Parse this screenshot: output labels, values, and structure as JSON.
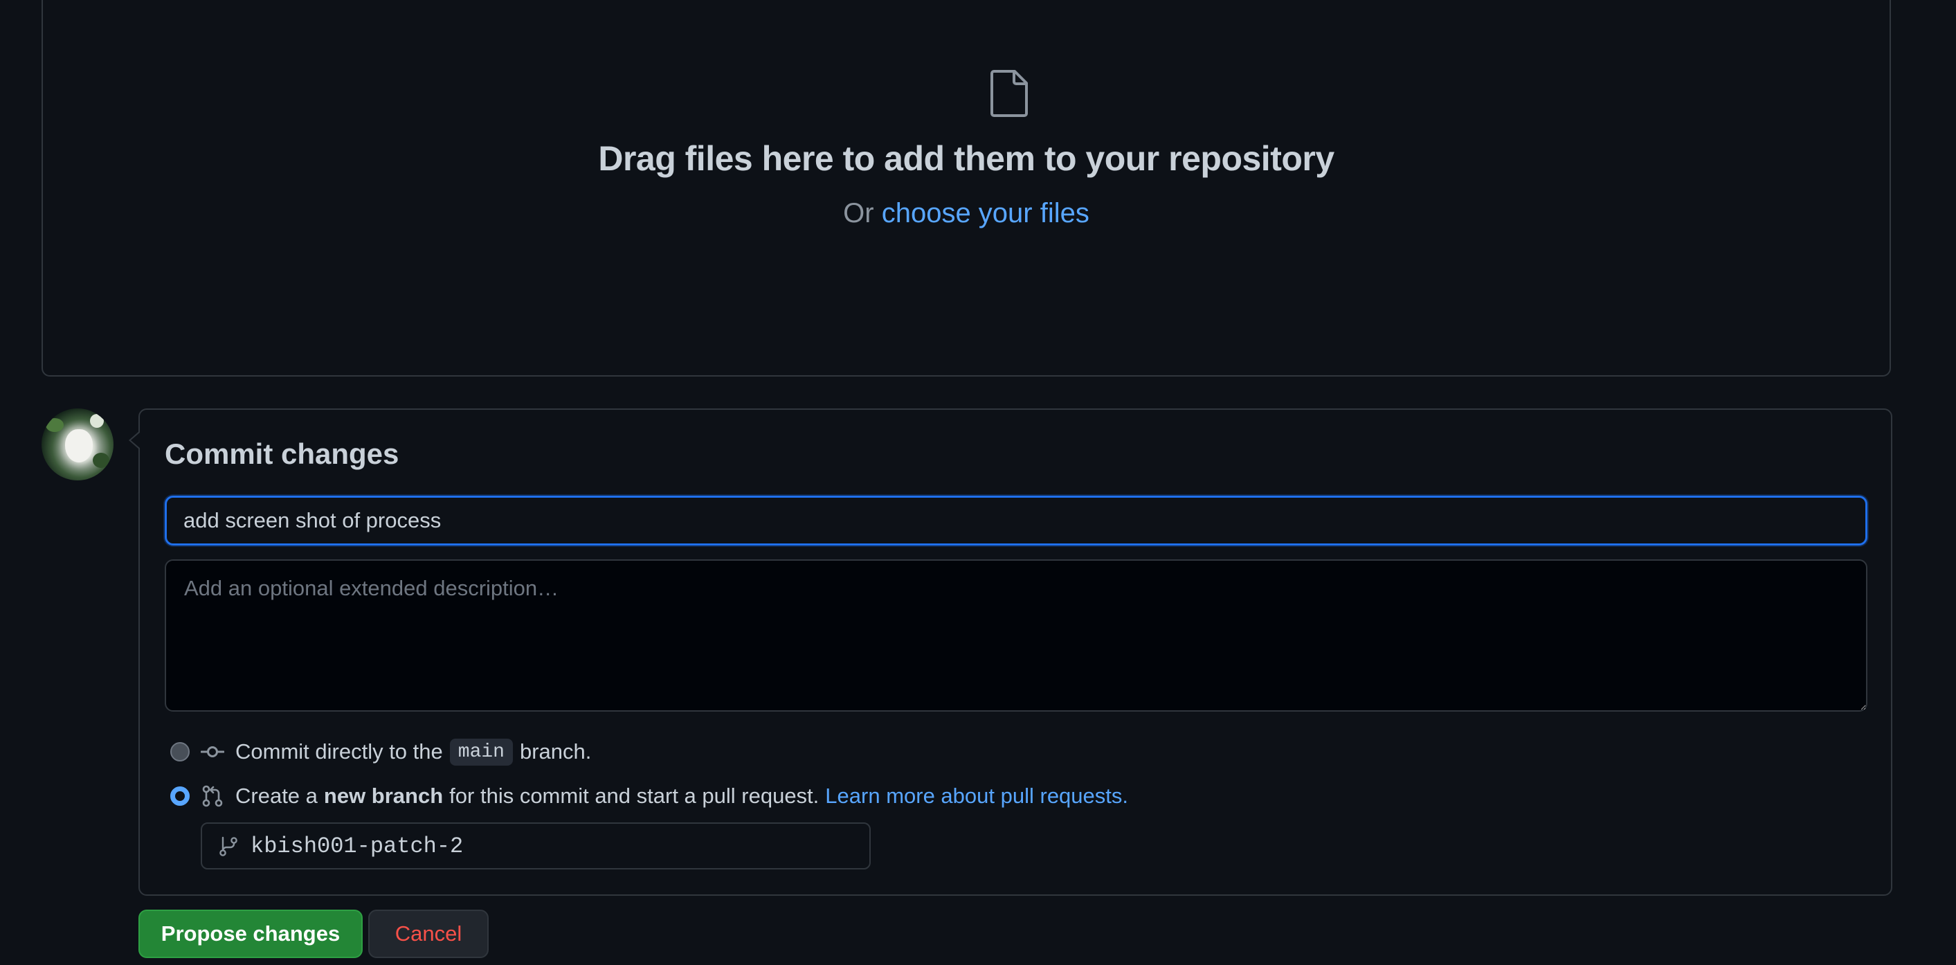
{
  "dropzone": {
    "icon": "file-icon",
    "title": "Drag files here to add them to your repository",
    "sub_prefix": "Or",
    "choose_link": "choose your files"
  },
  "commit": {
    "heading": "Commit changes",
    "summary_value": "add screen shot of process",
    "description_placeholder": "Add an optional extended description…",
    "options": {
      "direct": {
        "text_before": "Commit directly to the",
        "branch": "main",
        "text_after": "branch.",
        "selected": false,
        "icon": "git-commit-icon"
      },
      "new_branch": {
        "text_before": "Create a",
        "bold": "new branch",
        "text_after": "for this commit and start a pull request.",
        "learn_link": "Learn more about pull requests.",
        "selected": true,
        "icon": "git-pull-request-icon"
      }
    },
    "branch_name": "kbish001-patch-2",
    "branch_icon": "git-branch-icon"
  },
  "buttons": {
    "propose": "Propose changes",
    "cancel": "Cancel"
  },
  "colors": {
    "background": "#0d1117",
    "accent": "#58a6ff",
    "primary_button": "#238636",
    "danger_text": "#f85149",
    "focus_border": "#1f6feb"
  }
}
